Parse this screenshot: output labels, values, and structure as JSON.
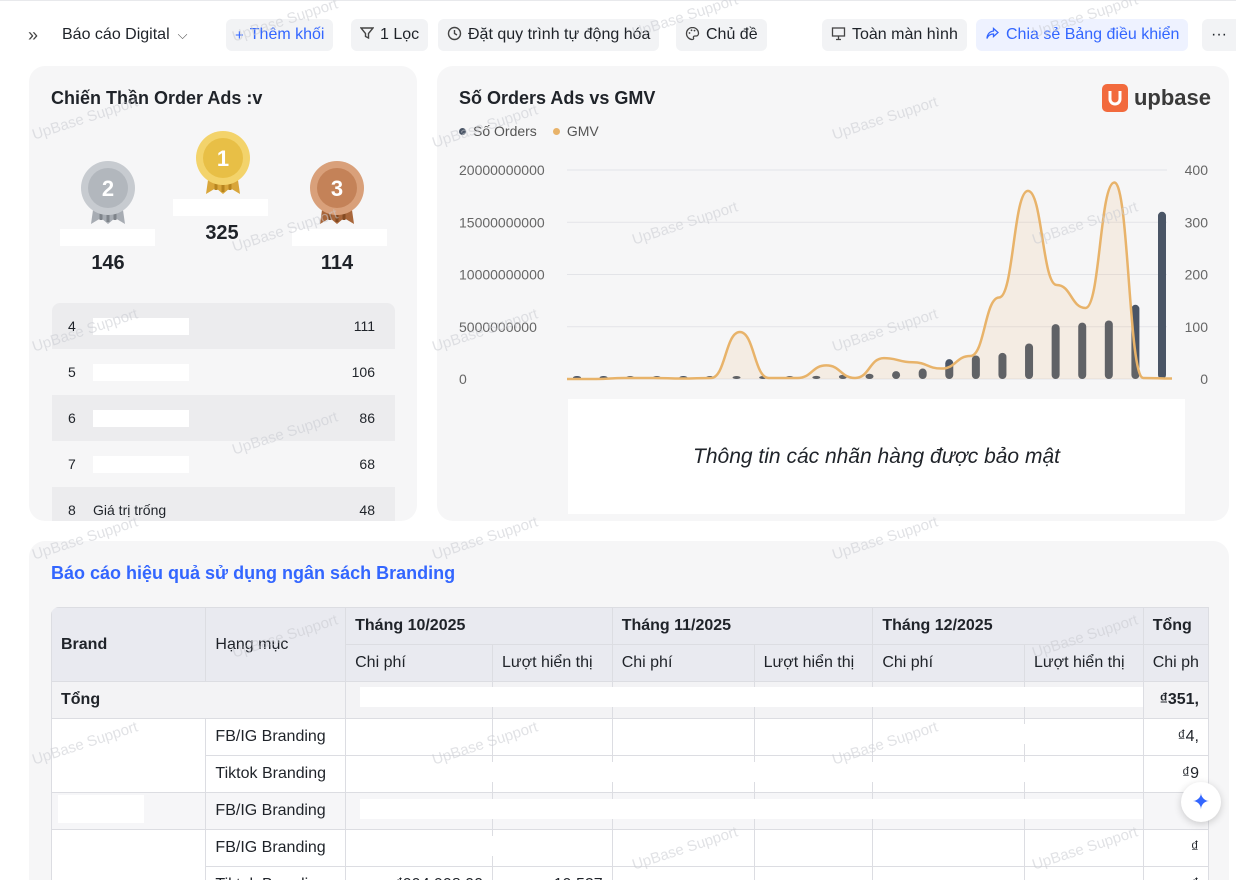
{
  "toolbar": {
    "report_name": "Báo cáo Digital",
    "add_block": "Thêm khối",
    "filter": "1 Lọc",
    "automation": "Đặt quy trình tự động hóa",
    "theme": "Chủ đề",
    "fullscreen": "Toàn màn hình",
    "share": "Chia sẻ Bảng điều khiển",
    "more": "···"
  },
  "leaderboard": {
    "title": "Chiến Thần Order Ads :v",
    "podium": [
      {
        "rank": "2",
        "value": "146"
      },
      {
        "rank": "1",
        "value": "325"
      },
      {
        "rank": "3",
        "value": "114"
      }
    ],
    "rows": [
      {
        "rank": "4",
        "name": "",
        "value": "111"
      },
      {
        "rank": "5",
        "name": "",
        "value": "106"
      },
      {
        "rank": "6",
        "name": "",
        "value": "86"
      },
      {
        "rank": "7",
        "name": "",
        "value": "68"
      },
      {
        "rank": "8",
        "name": "Giá trị trống",
        "value": "48"
      }
    ]
  },
  "chart_card": {
    "title": "Số Orders Ads vs GMV",
    "brand": "upbase",
    "confidential_note": "Thông tin các nhãn hàng được bảo mật"
  },
  "chart_data": {
    "type": "bar",
    "title": "Số Orders Ads vs GMV",
    "series": [
      {
        "name": "Số Orders",
        "kind": "bar",
        "axis": "right",
        "color": "#4a5566",
        "values": [
          5,
          1,
          1,
          1,
          1,
          1,
          2,
          2,
          4,
          6,
          8,
          10,
          15,
          20,
          38,
          45,
          50,
          68,
          105,
          108,
          112,
          142,
          320
        ]
      },
      {
        "name": "GMV",
        "kind": "line",
        "axis": "left",
        "color": "#e8b36a",
        "values": [
          0,
          0,
          100000000,
          100000000,
          50000000,
          100000000,
          4500000000,
          100000000,
          100000000,
          1300000000,
          100000000,
          2000000000,
          1600000000,
          1000000000,
          2200000000,
          7800000000,
          18000000000,
          9000000000,
          6800000000,
          18800000000,
          100000000,
          50000000
        ]
      }
    ],
    "y_left": {
      "ticks": [
        "20000000000",
        "15000000000",
        "10000000000",
        "5000000000",
        "0"
      ],
      "range": [
        0,
        20000000000
      ]
    },
    "y_right": {
      "ticks": [
        "400",
        "300",
        "200",
        "100",
        "0"
      ],
      "range": [
        0,
        400
      ]
    },
    "legend": "top-left",
    "grid": true
  },
  "branding_table": {
    "title": "Báo cáo hiệu quả sử dụng ngân sách Branding",
    "headers": {
      "brand": "Brand",
      "category": "Hạng mục",
      "months": [
        "Tháng 10/2025",
        "Tháng 11/2025",
        "Tháng 12/2025"
      ],
      "total": "Tổng",
      "cost": "Chi phí",
      "views": "Lượt hiển thị",
      "cost_partial": "Chi ph"
    },
    "total_row": {
      "label": "Tổng",
      "total_cost": "₫351,"
    },
    "rows": [
      {
        "category": "FB/IG Branding",
        "total_cost": "₫4,"
      },
      {
        "category": "Tiktok Branding",
        "total_cost": "₫9"
      },
      {
        "category": "FB/IG Branding",
        "total_cost": ""
      },
      {
        "category": "FB/IG Branding",
        "total_cost": "₫"
      },
      {
        "category": "Tiktok Branding",
        "total_cost": "₫",
        "oct_cost": "₫994,998.00",
        "oct_views": "19,527"
      }
    ]
  },
  "watermark": "UpBase Support"
}
